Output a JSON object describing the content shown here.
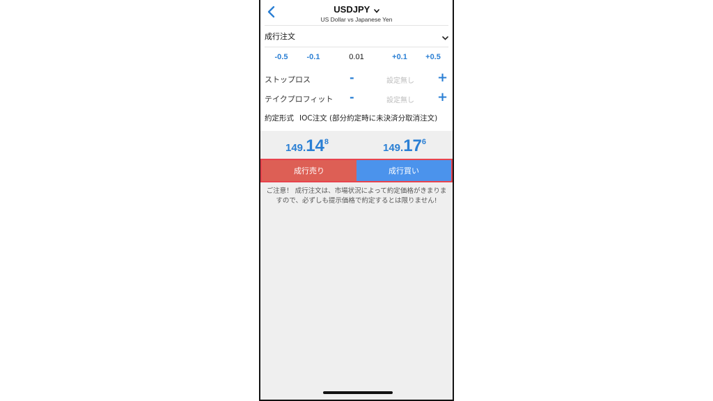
{
  "header": {
    "symbol": "USDJPY",
    "subtitle": "US Dollar vs Japanese Yen",
    "back_icon": "chevron-left-icon",
    "symbol_dropdown_icon": "chevron-down-icon"
  },
  "order_type": {
    "label": "成行注文",
    "dropdown_icon": "chevron-down-icon"
  },
  "volume": {
    "minus_big": "-0.5",
    "minus_small": "-0.1",
    "value": "0.01",
    "plus_small": "+0.1",
    "plus_big": "+0.5"
  },
  "stop_loss": {
    "label": "ストップロス",
    "minus": "-",
    "value": "設定無し",
    "plus": "+"
  },
  "take_profit": {
    "label": "テイクプロフィット",
    "minus": "-",
    "value": "設定無し",
    "plus": "+"
  },
  "fill_policy": {
    "label": "約定形式",
    "value": "IOC注文 (部分約定時に未決済分取消注文)"
  },
  "prices": {
    "sell": {
      "prefix": "149.",
      "big": "14",
      "sup": "8"
    },
    "buy": {
      "prefix": "149.",
      "big": "17",
      "sup": "6"
    }
  },
  "buttons": {
    "sell_label": "成行売り",
    "buy_label": "成行買い"
  },
  "notice": "ご注意！ 成行注文は、市場状況によって約定価格がきまりますので、必ずしも提示価格で約定するとは限りません!",
  "colors": {
    "accent_blue": "#2a7fd4",
    "sell_red": "#dd5f55",
    "buy_blue": "#4b93ec",
    "highlight_border": "#e8434d"
  }
}
